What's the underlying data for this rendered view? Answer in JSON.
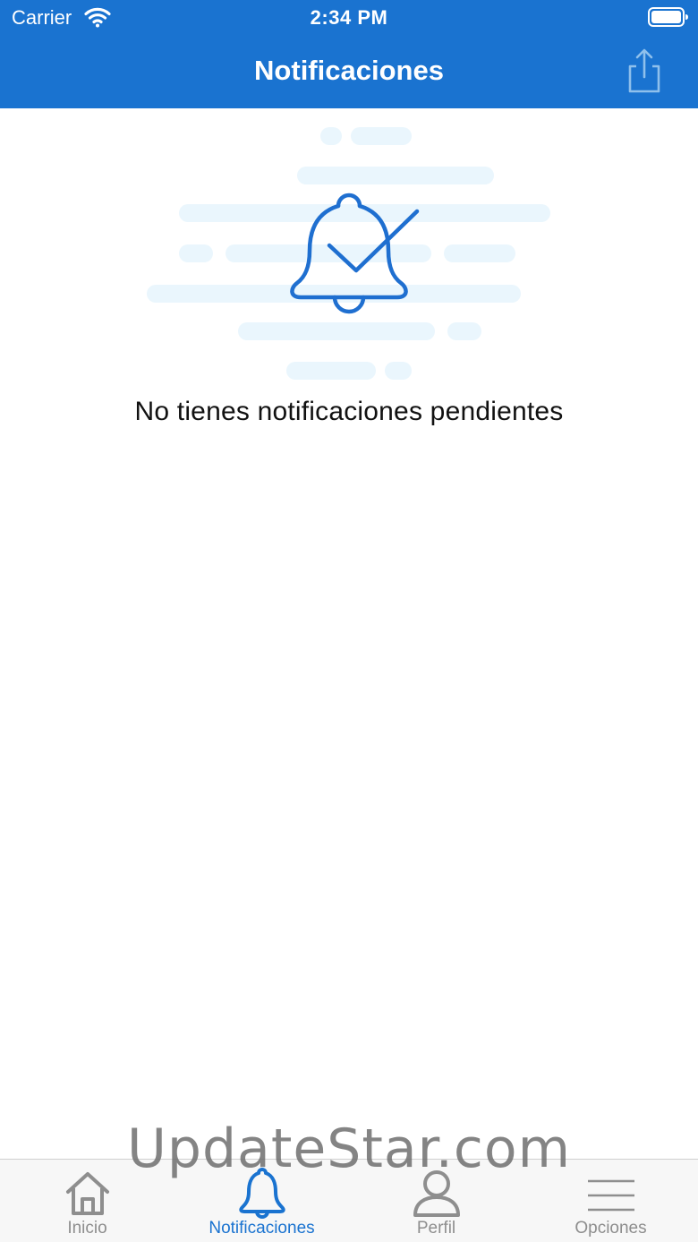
{
  "status_bar": {
    "carrier": "Carrier",
    "time": "2:34 PM",
    "wifi_icon": "wifi-icon",
    "battery_icon": "battery-icon"
  },
  "nav_bar": {
    "title": "Notificaciones",
    "share_icon": "share-icon",
    "background_color": "#1a73d0"
  },
  "empty_state": {
    "illustration_icon": "bell-check-icon",
    "message": "No tienes notificaciones pendientes",
    "icon_color": "#1f6fd0",
    "cloud_color": "#eaf6fd"
  },
  "watermark": {
    "text": "UpdateStar.com"
  },
  "tab_bar": {
    "active_color": "#1a73d0",
    "inactive_color": "#8e8e8e",
    "tabs": [
      {
        "label": "Inicio",
        "icon": "home-icon",
        "active": false
      },
      {
        "label": "Notificaciones",
        "icon": "bell-icon",
        "active": true
      },
      {
        "label": "Perfil",
        "icon": "person-icon",
        "active": false
      },
      {
        "label": "Opciones",
        "icon": "menu-icon",
        "active": false
      }
    ]
  }
}
